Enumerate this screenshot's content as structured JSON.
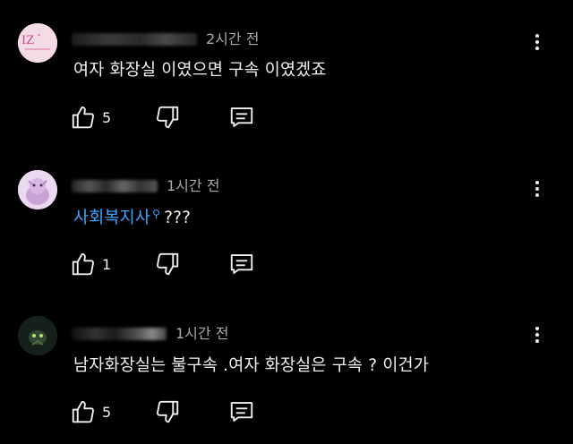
{
  "comments": [
    {
      "time": "2시간 전",
      "text": "여자 화장실 이였으면 구속 이였겠죠",
      "likes": "5",
      "avatar_color": "#f3d6e2"
    },
    {
      "time": "1시간 전",
      "tag": "사회복지사",
      "text": "???",
      "likes": "1",
      "avatar_color": "#e7d3ec"
    },
    {
      "time": "1시간 전",
      "text": "남자화장실는 불구속 .여자 화장실은 구속 ? 이건가",
      "likes": "5",
      "avatar_color": "#1e2a1e"
    }
  ],
  "icons": {
    "like": "thumbs-up-icon",
    "dislike": "thumbs-down-icon",
    "reply": "reply-icon",
    "menu": "more-vert-icon"
  },
  "colors": {
    "background": "#000000",
    "text": "#f1f1f1",
    "meta": "#aaaaaa",
    "link": "#3ea6ff"
  }
}
